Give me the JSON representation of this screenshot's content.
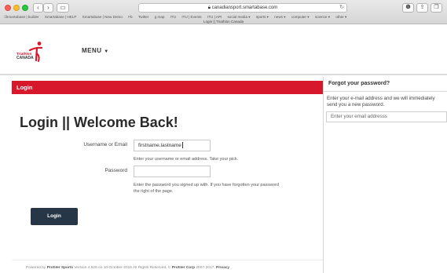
{
  "browser": {
    "url": "canadiansport.smartabase.com",
    "tab_title": "Login || Triathlon Canada",
    "bookmarks": [
      "Smartabase | builder",
      "Smartabase | HELP",
      "Smartabase | New Demo",
      "Fb",
      "Twitter",
      "g.map",
      "ITU",
      "ITU | Events",
      "ITU | API",
      "social media ▾",
      "sports ▾",
      "news ▾",
      "computer ▾",
      "science ▾",
      "other ▾"
    ]
  },
  "header": {
    "logo_line1": "Triathlon",
    "logo_line2": "CANADA",
    "menu_label": "MENU",
    "menu_arrow": "▼"
  },
  "login": {
    "bar_label": "Login",
    "heading": "Login || Welcome Back!",
    "username_label": "Username or Email",
    "username_value": "firstname.lastname",
    "username_help": "Enter your username or email address. Take your pick.",
    "password_label": "Password",
    "password_help_line1": "Enter the password you signed up with. If you have forgotten your password",
    "password_help_line2": "the right of the page.",
    "button_label": "Login"
  },
  "side": {
    "title": "Forgot your password?",
    "text": "Enter your e-mail address and we will immediately send you a new password.",
    "email_placeholder": "Enter your email addresss"
  },
  "footer": {
    "powered_prefix": "Powered by",
    "brand": "Profiler Sports",
    "middle": "Version 4.920 on 10-October-2016 All Rights Reserved. ©",
    "corp": "Profiler Corp",
    "years": "2007-2017.",
    "privacy": "Privacy"
  },
  "colors": {
    "accent_red": "#d7172c",
    "button_navy": "#263647"
  }
}
